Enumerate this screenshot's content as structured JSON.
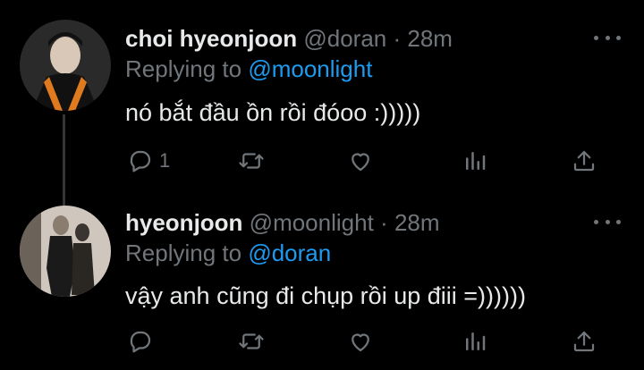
{
  "tweets": [
    {
      "name": "choi hyeonjoon",
      "handle": "@doran",
      "dot": "·",
      "time": "28m",
      "replying_prefix": "Replying to",
      "replying_to": "@moonlight",
      "text": "nó bắt đầu ồn rồi đóoo :)))))",
      "reply_count": "1",
      "avatar_colors": {
        "bg": "#2a2a2a",
        "accent": "#e07a1f",
        "face": "#d9c8b8"
      }
    },
    {
      "name": "hyeonjoon",
      "handle": "@moonlight",
      "dot": "·",
      "time": "28m",
      "replying_prefix": "Replying to",
      "replying_to": "@doran",
      "text": "vậy anh cũng đi chụp rồi up điii =))))))",
      "reply_count": "",
      "avatar_colors": {
        "bg": "#cfc7bd",
        "accent": "#1a1a1a",
        "face": "#8a7d70"
      }
    }
  ],
  "icons": [
    "reply-icon",
    "retweet-icon",
    "like-icon",
    "views-icon",
    "share-icon",
    "more-icon"
  ],
  "colors": {
    "background": "#000000",
    "text": "#e7e9ea",
    "muted": "#71767b",
    "link": "#1d9bf0"
  }
}
